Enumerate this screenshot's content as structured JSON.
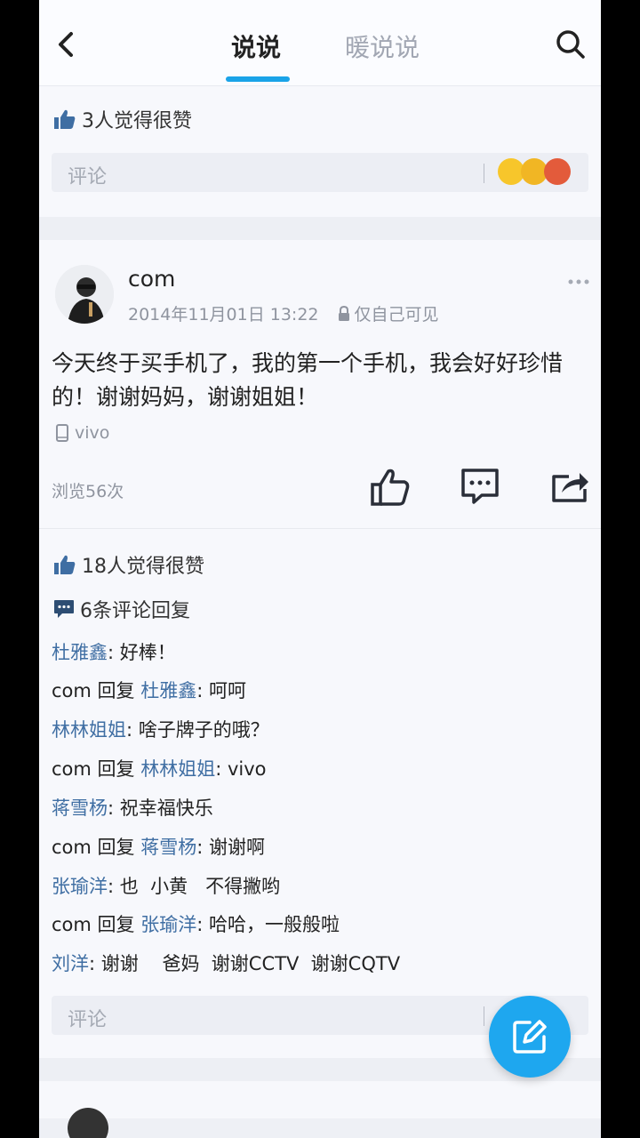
{
  "header": {
    "tabs": [
      {
        "label": "说说",
        "active": true
      },
      {
        "label": "暖说说",
        "active": false
      }
    ],
    "back_icon": "chevron-left-icon",
    "search_icon": "search-icon",
    "accent_color": "#1aa3e8"
  },
  "prev_post": {
    "likes_text": "3人觉得很赞",
    "comment_placeholder": "评论"
  },
  "post": {
    "username": "com",
    "timestamp": "2014年11月01日 13:22",
    "privacy": "仅自己可见",
    "text": "今天终于买手机了，我的第一个手机，我会好好珍惜的！谢谢妈妈，谢谢姐姐！",
    "device": "vivo",
    "views": "浏览56次",
    "likes_text": "18人觉得很赞",
    "comments_count_text": "6条评论回复",
    "comments": [
      {
        "name": "杜雅鑫",
        "text": ": 好棒！"
      },
      {
        "name": "com",
        "reply_word": " 回复 ",
        "target": "杜雅鑫",
        "text": ": 呵呵"
      },
      {
        "name": "林林姐姐",
        "text": ": 啥子牌子的哦？"
      },
      {
        "name": "com",
        "reply_word": " 回复 ",
        "target": "林林姐姐",
        "text": ": vivo"
      },
      {
        "name": "蒋雪杨",
        "text": ": 祝幸福快乐"
      },
      {
        "name": "com",
        "reply_word": " 回复 ",
        "target": "蒋雪杨",
        "text": ": 谢谢啊"
      },
      {
        "name": "张瑜洋",
        "text": ": 也  小黄   不得撇哟"
      },
      {
        "name": "com",
        "reply_word": " 回复 ",
        "target": "张瑜洋",
        "text": ": 哈哈，一般般啦"
      },
      {
        "name": "刘洋",
        "text": ": 谢谢    爸妈  谢谢CCTV  谢谢CQTV"
      }
    ],
    "comment_placeholder": "评论",
    "actions": [
      "thumbs-up-icon",
      "comment-icon",
      "share-icon"
    ]
  },
  "fab": {
    "icon": "edit-icon",
    "color": "#1ea7ef"
  }
}
